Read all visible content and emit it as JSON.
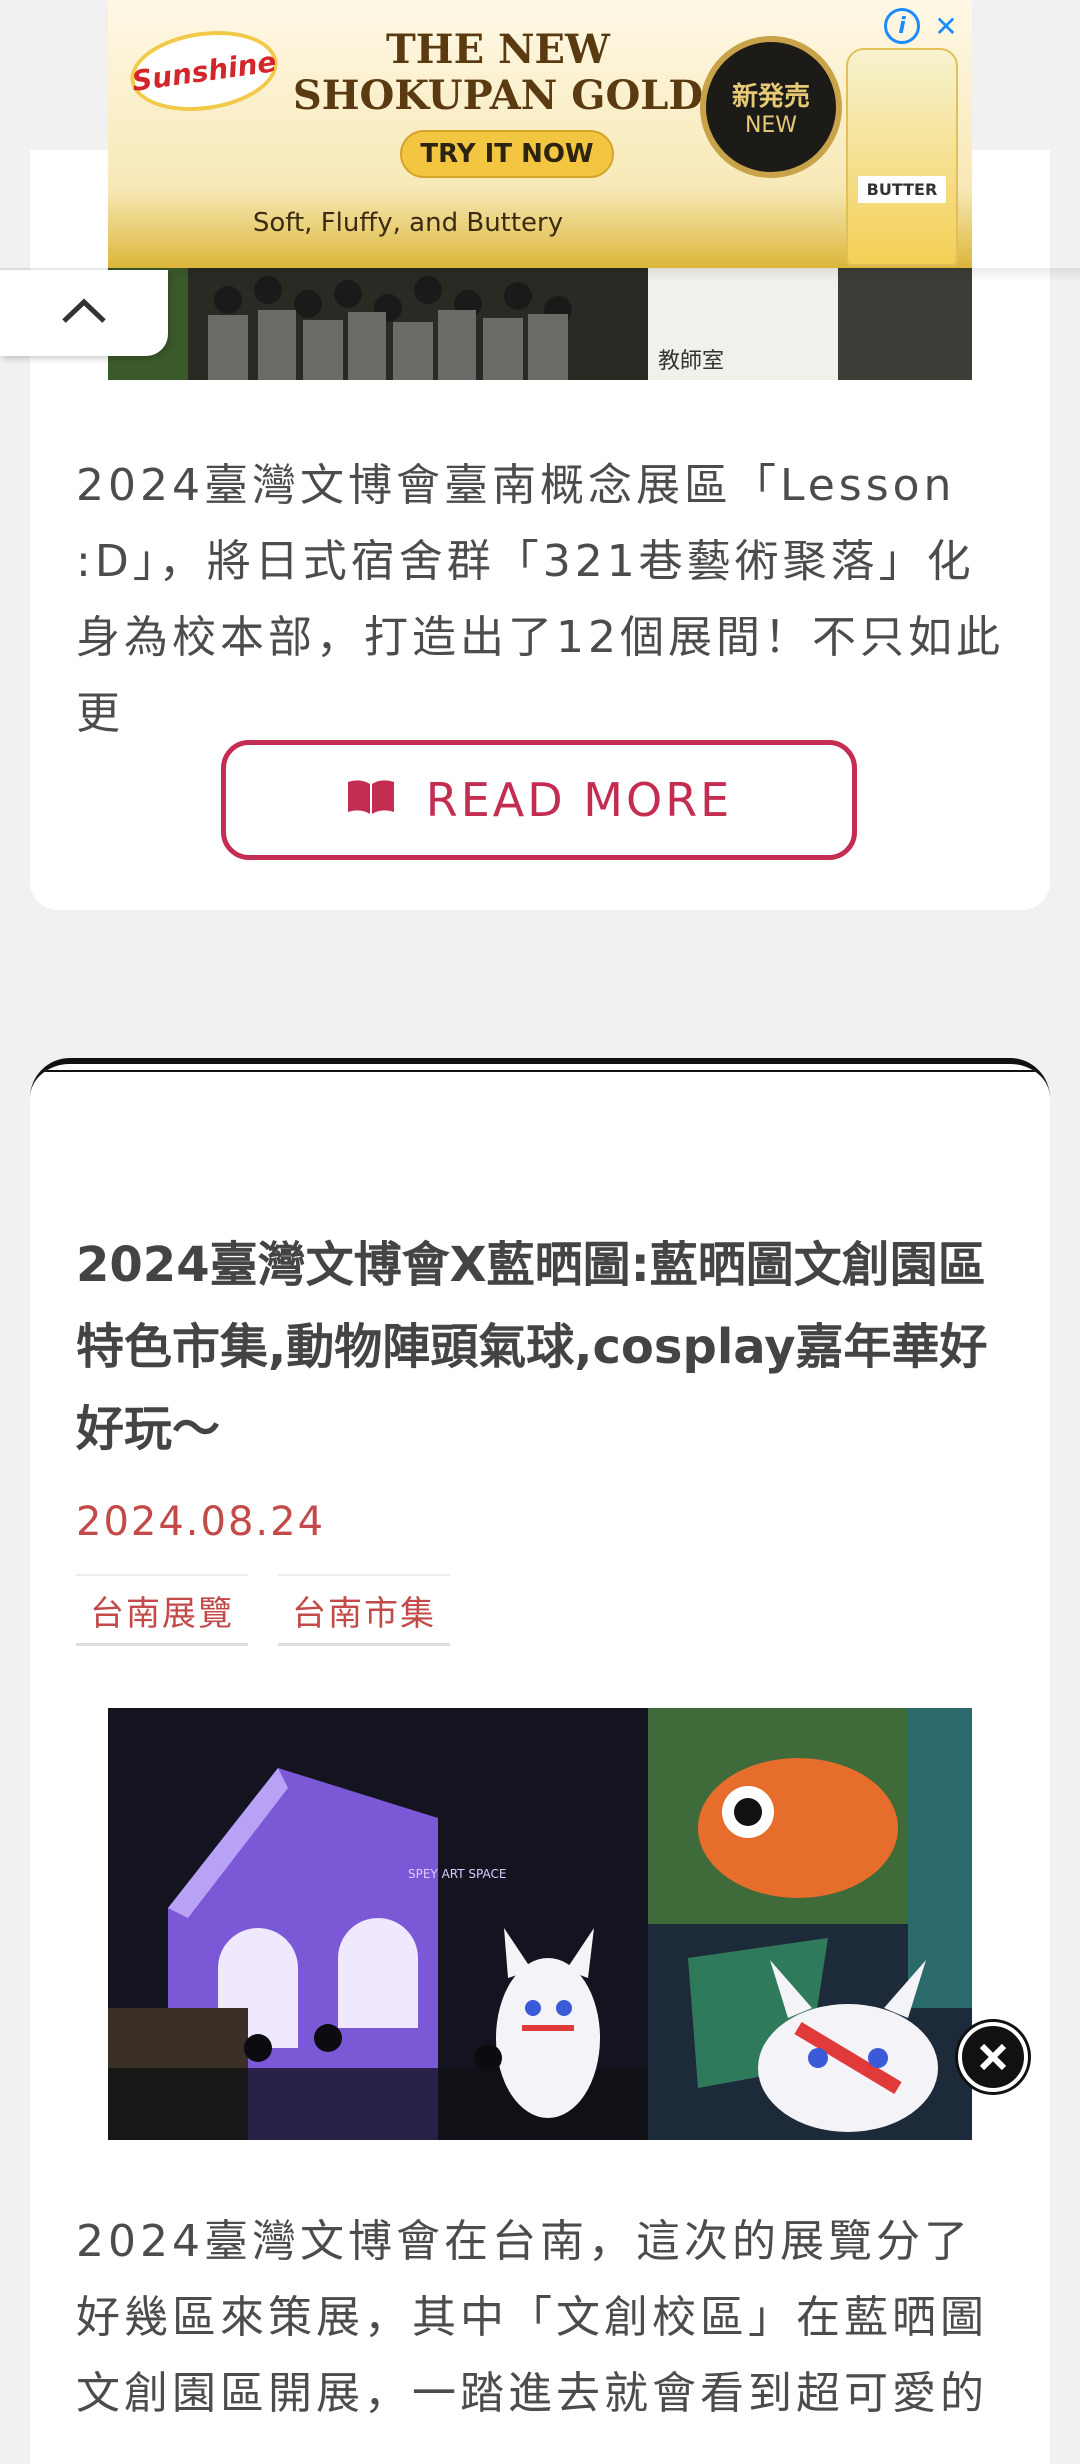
{
  "ad": {
    "brand": "Sunshine",
    "headline_1": "THE NEW",
    "headline_2": "SHOKUPAN GOLD",
    "cta": "TRY IT NOW",
    "tagline": "Soft, Fluffy, and Buttery",
    "seal_top": "新発売",
    "seal_bottom": "NEW",
    "bag_label": "BUTTER",
    "info_icon": "i",
    "close_icon": "✕"
  },
  "post1": {
    "excerpt": "2024臺灣文博會臺南概念展區「Lesson :D」，將日式宿舍群「321巷藝術聚落」化身為校本部，打造出了12個展間！不只如此更",
    "photo_sign": "教師室",
    "read_more": "READ MORE"
  },
  "post2": {
    "title": "2024臺灣文博會X藍晒圖:藍晒圖文創園區特色市集,動物陣頭氣球,cosplay嘉年華好好玩～",
    "date": "2024.08.24",
    "tags": [
      "台南展覽",
      "台南市集"
    ],
    "photo_sign": "SPEY ART SPACE",
    "excerpt": "2024臺灣文博會在台南，這次的展覽分了好幾區來策展，其中「文創校區」在藍晒圖文創園區開展，一踏進去就會看到超可愛的"
  },
  "colors": {
    "accent": "#c42d52",
    "date": "#c24a48",
    "background": "#f1f1f1"
  }
}
